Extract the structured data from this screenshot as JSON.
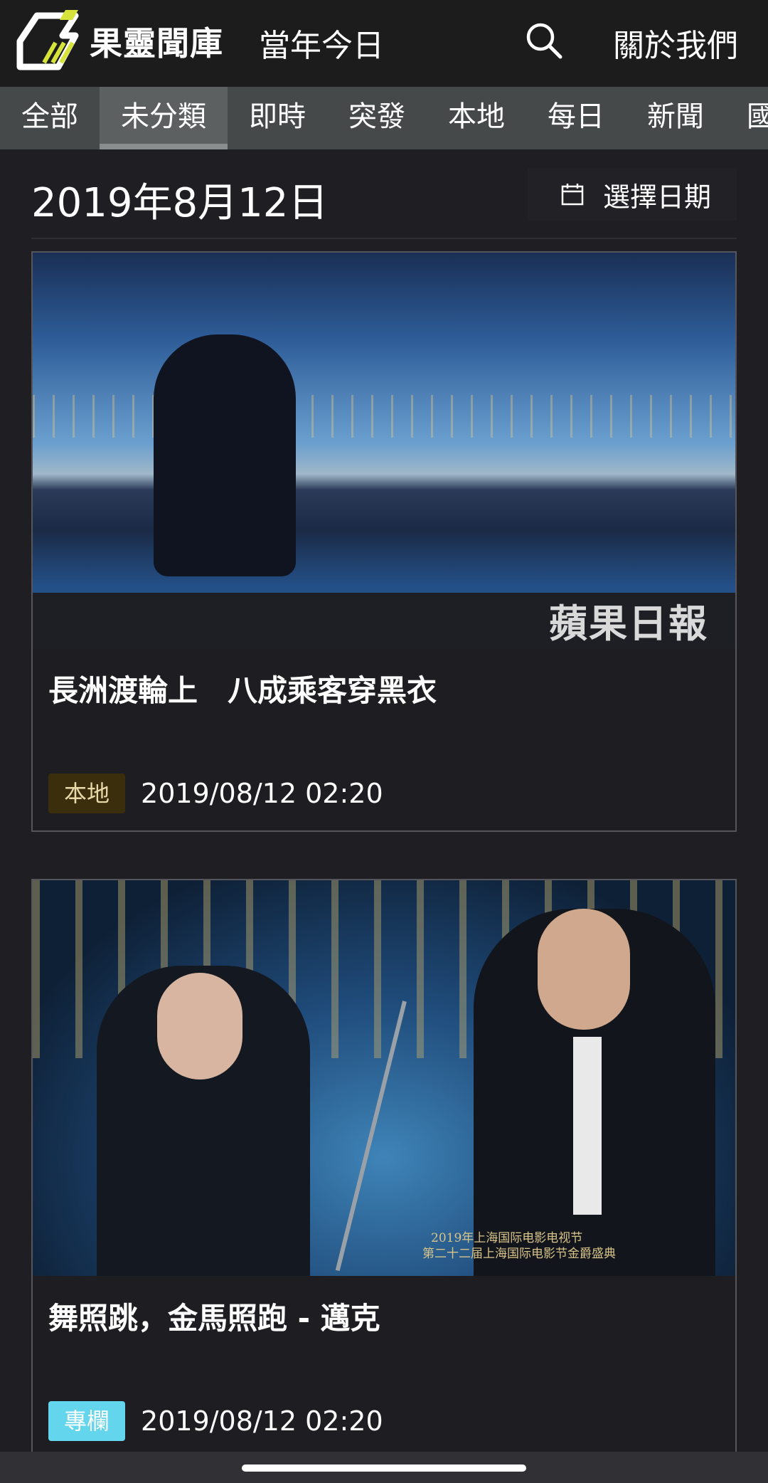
{
  "header": {
    "logo_text": "果靈聞庫",
    "today_link": "當年今日",
    "about_link": "關於我們",
    "search_icon": "search-icon"
  },
  "tabs": [
    {
      "label": "全部",
      "active": false
    },
    {
      "label": "未分類",
      "active": true
    },
    {
      "label": "即時",
      "active": false
    },
    {
      "label": "突發",
      "active": false
    },
    {
      "label": "本地",
      "active": false
    },
    {
      "label": "每日",
      "active": false
    },
    {
      "label": "新聞",
      "active": false
    },
    {
      "label": "國",
      "active": false
    }
  ],
  "date_bar": {
    "date": "2019年8月12日",
    "pick_date_label": "選擇日期",
    "pick_date_icon": "calendar-icon"
  },
  "articles": [
    {
      "title": "長洲渡輪上　八成乘客穿黑衣",
      "category": "本地",
      "category_color": "#3a2e0c",
      "timestamp": "2019/08/12 02:20",
      "image_watermark": "蘋果日報"
    },
    {
      "title": "舞照跳，金馬照跑 - 邁克",
      "category": "專欄",
      "category_color": "#63d6ee",
      "timestamp": "2019/08/12 02:20",
      "image_caption_1": "2019年上海国际电影电视节",
      "image_caption_2": "第二十二届上海国际电影节金爵盛典"
    }
  ],
  "colors": {
    "background": "#1f1f23",
    "header": "#1c1c1c",
    "tab_bar": "#46494a",
    "logo_accent": "#d6e33a"
  }
}
